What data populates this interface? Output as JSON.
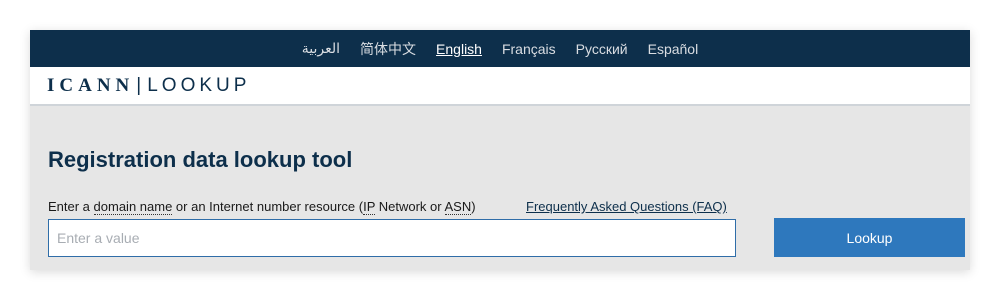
{
  "languages": {
    "arabic": "العربية",
    "chinese": "简体中文",
    "english": "English",
    "french": "Français",
    "russian": "Русский",
    "spanish": "Español",
    "active": "English"
  },
  "brand": {
    "primary": "ICANN",
    "separator": "|",
    "secondary": "LOOKUP"
  },
  "main": {
    "title": "Registration data lookup tool",
    "instructions": {
      "part1": "Enter a ",
      "domain_name": "domain name",
      "part2": " or an Internet number resource (",
      "ip": "IP",
      "part3": " Network or ",
      "asn": "ASN",
      "part4": ")"
    },
    "faq_link": "Frequently Asked Questions (FAQ)",
    "input_placeholder": "Enter a value",
    "input_value": "",
    "button_label": "Lookup"
  },
  "colors": {
    "navy": "#0d2f4b",
    "button": "#2e78bd",
    "background": "#e6e6e6"
  }
}
